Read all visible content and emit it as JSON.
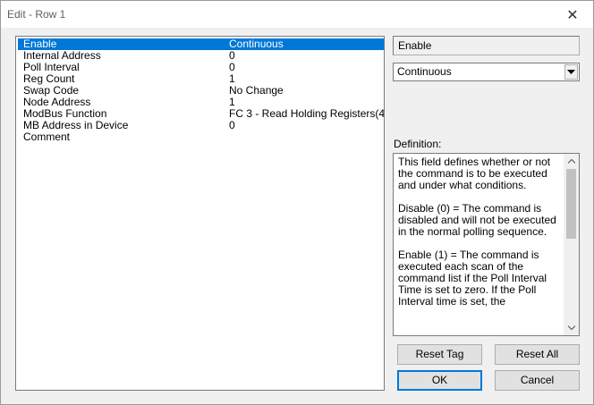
{
  "window": {
    "title": "Edit - Row 1",
    "close_glyph": "✕"
  },
  "properties": [
    {
      "name": "Enable",
      "value": "Continuous",
      "selected": true
    },
    {
      "name": "Internal Address",
      "value": "0"
    },
    {
      "name": "Poll Interval",
      "value": "0"
    },
    {
      "name": "Reg Count",
      "value": "1"
    },
    {
      "name": "Swap Code",
      "value": "No Change"
    },
    {
      "name": "Node Address",
      "value": "1"
    },
    {
      "name": "ModBus Function",
      "value": "FC 3 - Read Holding Registers(4"
    },
    {
      "name": "MB Address in Device",
      "value": "0"
    },
    {
      "name": "Comment",
      "value": ""
    }
  ],
  "editor": {
    "field_name": "Enable",
    "selected_value": "Continuous"
  },
  "definition": {
    "label": "Definition:",
    "text": "This field defines whether or not the command is to be executed and under what conditions.\n\nDisable (0) = The command is disabled and will not be executed in the normal polling sequence.\n\nEnable (1) = The command is executed each scan of the command list if the Poll Interval Time is set to zero. If the Poll Interval time is set, the"
  },
  "buttons": {
    "reset_tag": "Reset Tag",
    "reset_all": "Reset All",
    "ok": "OK",
    "cancel": "Cancel"
  },
  "colors": {
    "selection": "#0078d7",
    "default_button_border": "#0078d7"
  }
}
